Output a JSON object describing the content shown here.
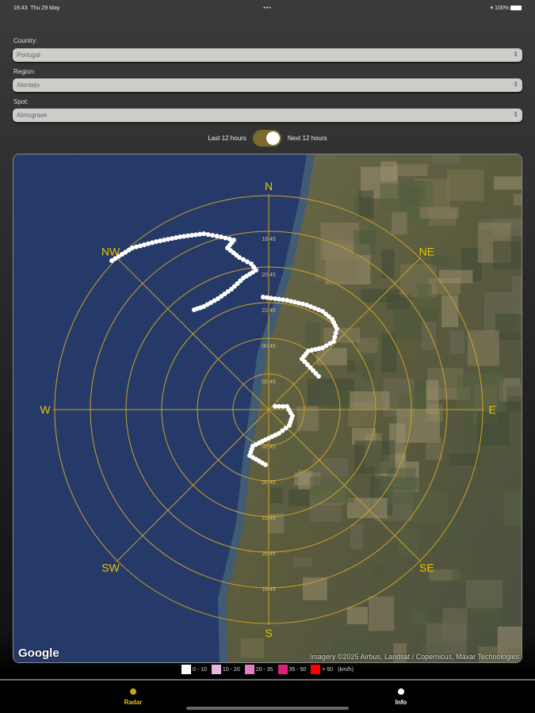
{
  "status": {
    "time": "16:43",
    "date": "Thu 29 May",
    "battery": "100%"
  },
  "form": {
    "country": {
      "label": "Country:",
      "value": "Portugal"
    },
    "region": {
      "label": "Region:",
      "value": "Alentejo"
    },
    "spot": {
      "label": "Spot:",
      "value": "Almograve"
    }
  },
  "toggle": {
    "left_label": "Last 12 hours",
    "right_label": "Next 12 hours",
    "on": true
  },
  "radar": {
    "directions": {
      "n": "N",
      "ne": "NE",
      "e": "E",
      "se": "SE",
      "s": "S",
      "sw": "SW",
      "w": "W",
      "nw": "NW"
    },
    "ring_labels_top": [
      "18:45",
      "20:45",
      "22:45",
      "00:45",
      "02:45"
    ],
    "ring_labels_bottom": [
      "02:45",
      "00:45",
      "22:45",
      "20:45",
      "18:45"
    ],
    "google": "Google",
    "credit": "Imagery ©2025 Airbus, Landsat / Copernicus, Maxar Technologies"
  },
  "legend": {
    "items": [
      {
        "label": "0 - 10",
        "color": "#ffffff"
      },
      {
        "label": "10 - 20",
        "color": "#e6b8e0"
      },
      {
        "label": "20 - 35",
        "color": "#e57ec0"
      },
      {
        "label": "35 - 50",
        "color": "#e0207a"
      },
      {
        "label": "> 50",
        "color": "#ff0000"
      }
    ],
    "unit": "(km/h)"
  },
  "tabs": {
    "radar": "Radar",
    "info": "Info"
  },
  "colors": {
    "accent": "#e8c400",
    "ring": "#c9a227"
  }
}
